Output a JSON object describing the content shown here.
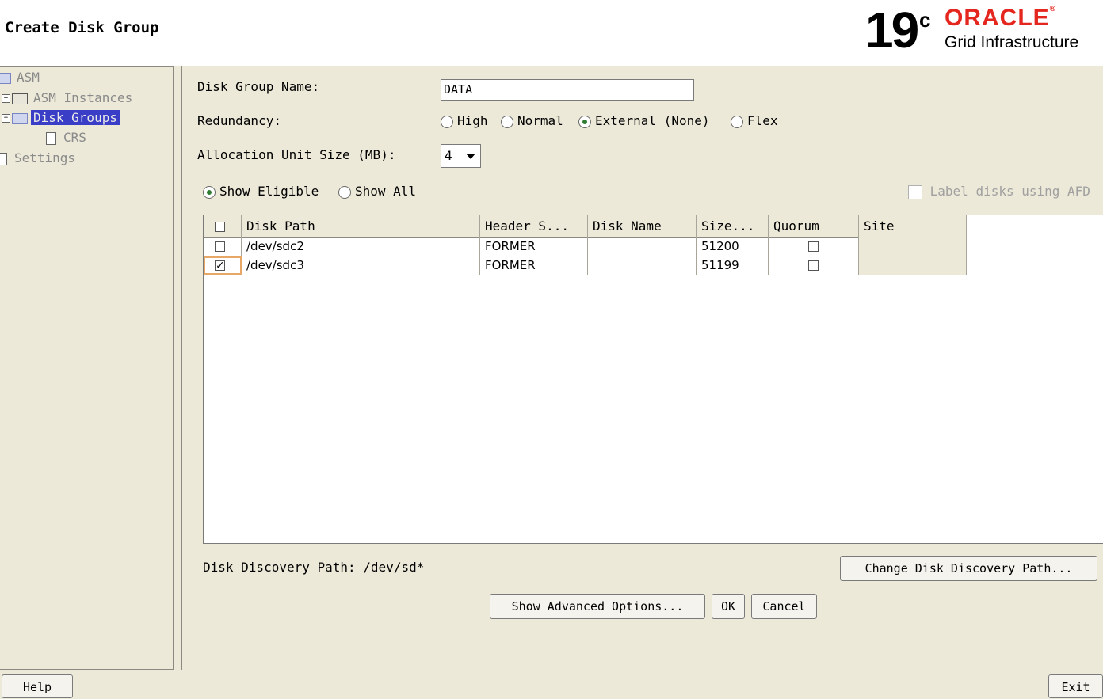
{
  "header": {
    "title": "Create Disk Group",
    "brand_version": "19",
    "brand_sup": "c",
    "brand_oracle": "ORACLE",
    "brand_product": "Grid Infrastructure"
  },
  "sidebar": {
    "items": [
      {
        "label": "ASM"
      },
      {
        "label": "ASM Instances"
      },
      {
        "label": "Disk Groups"
      },
      {
        "label": "CRS"
      },
      {
        "label": "Settings"
      }
    ]
  },
  "form": {
    "disk_group_name_label": "Disk Group Name:",
    "disk_group_name_value": "DATA",
    "redundancy_label": "Redundancy:",
    "redundancy_options": [
      "High",
      "Normal",
      "External (None)",
      "Flex"
    ],
    "redundancy_selected": "External (None)",
    "allocation_label": "Allocation Unit Size (MB):",
    "allocation_value": "4",
    "show_options": [
      "Show Eligible",
      "Show All"
    ],
    "show_selected": "Show Eligible",
    "label_disks_afd": "Label disks using AFD"
  },
  "table": {
    "columns": [
      "",
      "Disk Path",
      "Header S...",
      "Disk Name",
      "Size...",
      "Quorum",
      "Site"
    ],
    "rows": [
      {
        "selected": false,
        "disk_path": "/dev/sdc2",
        "header_status": "FORMER",
        "disk_name": "",
        "size": "51200",
        "quorum": false,
        "site": ""
      },
      {
        "selected": true,
        "disk_path": "/dev/sdc3",
        "header_status": "FORMER",
        "disk_name": "",
        "size": "51199",
        "quorum": false,
        "site": ""
      }
    ]
  },
  "discovery": {
    "label": "Disk Discovery Path: /dev/sd*",
    "change_button": "Change Disk Discovery Path..."
  },
  "buttons": {
    "advanced": "Show Advanced Options...",
    "ok": "OK",
    "cancel": "Cancel",
    "help": "Help",
    "exit": "Exit"
  }
}
